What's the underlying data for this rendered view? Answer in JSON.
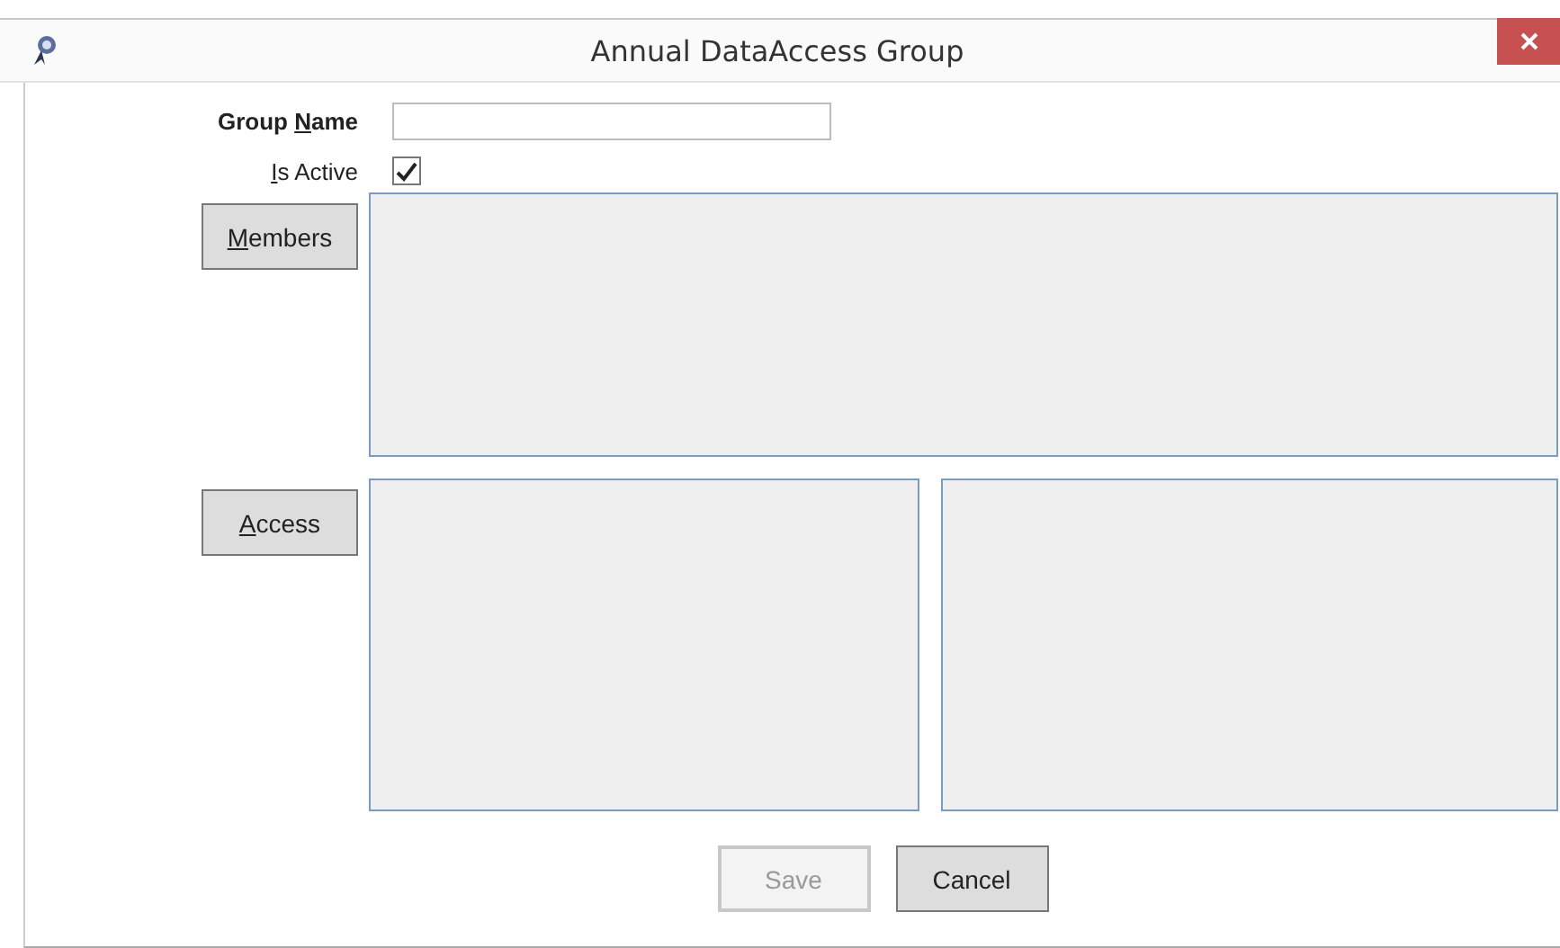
{
  "window": {
    "title": "Annual DataAccess Group"
  },
  "group_name": {
    "label": {
      "before": "Group ",
      "key": "N",
      "after": "ame"
    }
  },
  "is_active": {
    "label": {
      "key": "I",
      "after": "s Active"
    },
    "checked": true
  },
  "members": {
    "button": {
      "key": "M",
      "after": "embers"
    }
  },
  "access": {
    "button": {
      "key": "A",
      "after": "ccess"
    }
  },
  "buttons": [
    {
      "label": "Save",
      "disabled": true
    },
    {
      "label": "Cancel",
      "disabled": false
    }
  ]
}
